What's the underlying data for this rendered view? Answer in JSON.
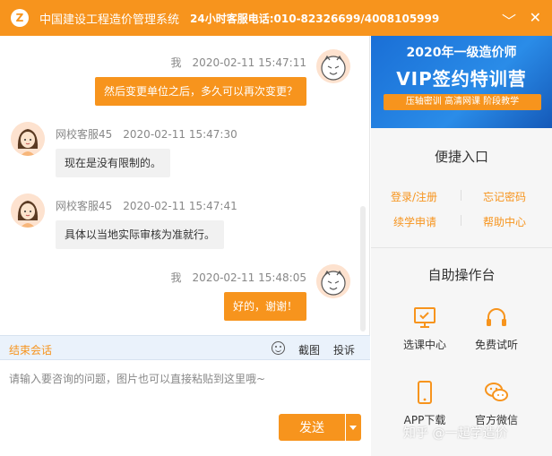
{
  "window": {
    "title": "中国建设工程造价管理系统",
    "hotline": "24小时客服电话:010-82326699/4008105999",
    "logo_glyph": "Z",
    "minimize_glyph": "﹀",
    "close_glyph": "✕"
  },
  "colors": {
    "brand": "#f7941d",
    "banner_blue": "#1a6fd6"
  },
  "messages": [
    {
      "from": "me",
      "sender": "我",
      "time": "2020-02-11 15:47:11",
      "text": "然后变更单位之后，多久可以再次变更？"
    },
    {
      "from": "agent",
      "sender": "网校客服45",
      "time": "2020-02-11 15:47:30",
      "text": "现在是没有限制的。"
    },
    {
      "from": "agent",
      "sender": "网校客服45",
      "time": "2020-02-11 15:47:41",
      "text": "具体以当地实际审核为准就行。"
    },
    {
      "from": "me",
      "sender": "我",
      "time": "2020-02-11 15:48:05",
      "text": "好的，谢谢！"
    }
  ],
  "toolbar": {
    "end_chat": "结束会话",
    "screenshot": "截图",
    "complaint": "投诉"
  },
  "input": {
    "placeholder": "请输入要咨询的问题，图片也可以直接粘贴到这里哦~",
    "value": ""
  },
  "send": {
    "label": "发送"
  },
  "banner": {
    "year_line": "2020年一级造价师",
    "headline": "VIP签约特训营",
    "tagline": "压轴密训 高清网课 阶段教学"
  },
  "quick_entry": {
    "title": "便捷入口",
    "links": [
      "登录/注册",
      "忘记密码",
      "续学申请",
      "帮助中心"
    ]
  },
  "self_service": {
    "title": "自助操作台",
    "items": [
      {
        "label": "选课中心",
        "icon": "monitor-icon"
      },
      {
        "label": "免费试听",
        "icon": "headphones-icon"
      },
      {
        "label": "APP下载",
        "icon": "phone-icon"
      },
      {
        "label": "官方微信",
        "icon": "wechat-icon"
      }
    ]
  },
  "watermark": "知乎 @一起学造价"
}
